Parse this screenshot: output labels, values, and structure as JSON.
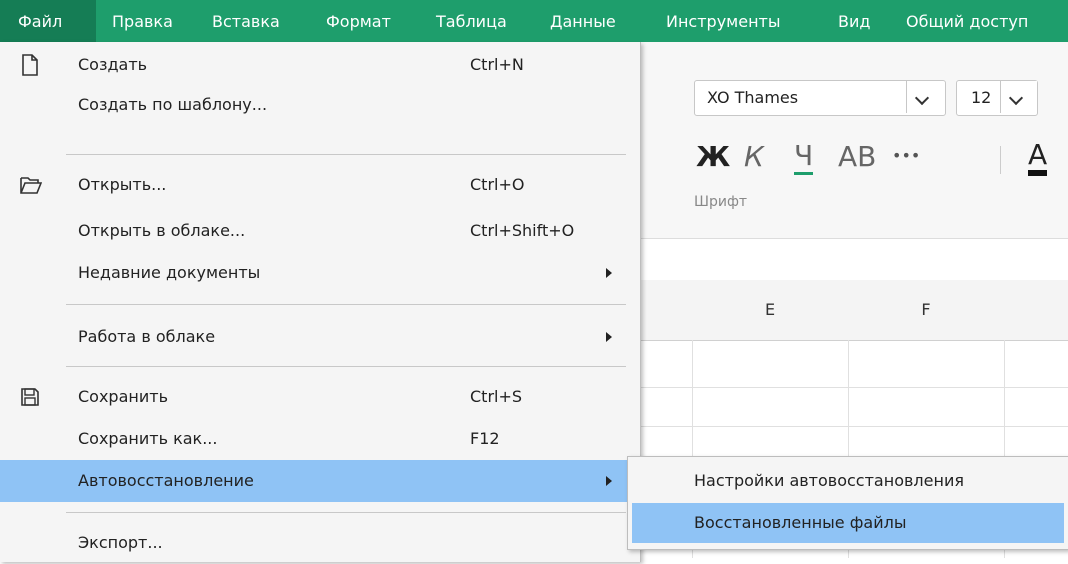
{
  "menubar": {
    "items": [
      "Файл",
      "Правка",
      "Вставка",
      "Формат",
      "Таблица",
      "Данные",
      "Инструменты",
      "Вид",
      "Общий доступ"
    ],
    "active": "Файл"
  },
  "ribbon": {
    "font_name": "XO Thames",
    "font_size": "12",
    "bold": "Ж",
    "italic": "К",
    "underline": "Ч",
    "caps": "АВ",
    "more": "•••",
    "color": "А",
    "group_label": "Шрифт"
  },
  "grid": {
    "columns": [
      "E",
      "F"
    ]
  },
  "file_menu": {
    "items": [
      {
        "label": "Создать",
        "shortcut": "Ctrl+N",
        "icon": "new-document-icon"
      },
      {
        "label": "Создать по шаблону...",
        "shortcut": ""
      },
      {
        "label": "Открыть...",
        "shortcut": "Ctrl+O",
        "icon": "open-folder-icon"
      },
      {
        "label": "Открыть в облаке...",
        "shortcut": "Ctrl+Shift+O"
      },
      {
        "label": "Недавние документы",
        "shortcut": "",
        "submenu": true
      },
      {
        "label": "Работа в облаке",
        "shortcut": "",
        "submenu": true
      },
      {
        "label": "Сохранить",
        "shortcut": "Ctrl+S",
        "icon": "save-icon"
      },
      {
        "label": "Сохранить как...",
        "shortcut": "F12"
      },
      {
        "label": "Автовосстановление",
        "shortcut": "",
        "submenu": true,
        "highlighted": true
      },
      {
        "label": "Экспорт...",
        "shortcut": ""
      }
    ]
  },
  "autorecover_submenu": {
    "items": [
      {
        "label": "Настройки автовосстановления"
      },
      {
        "label": "Восстановленные файлы",
        "highlighted": true
      }
    ]
  },
  "colors": {
    "menubar": "#1e9e6c",
    "highlight": "#8fc3f5",
    "menu_bg": "#f5f5f5"
  }
}
